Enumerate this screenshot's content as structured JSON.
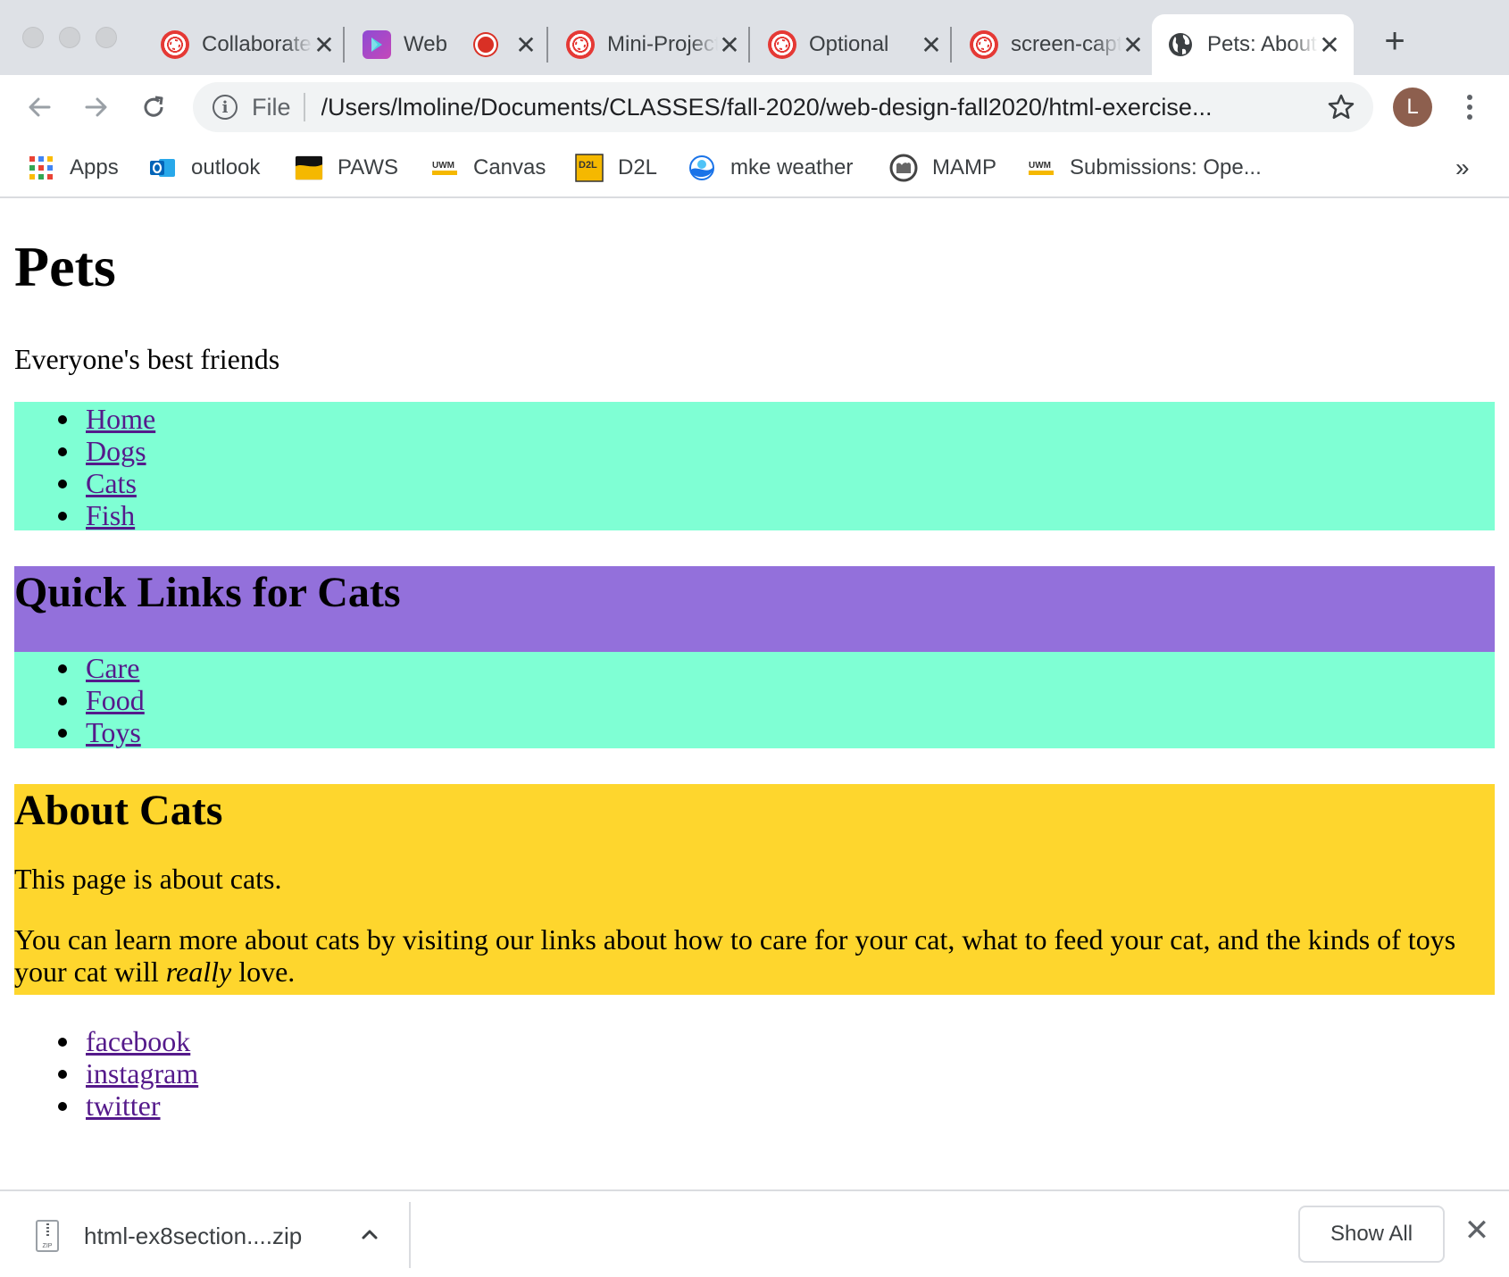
{
  "browser": {
    "tabs": [
      {
        "title": "Collaborate",
        "icon": "canvas-icon"
      },
      {
        "title": "Web",
        "icon": "web-app-icon",
        "recording": true
      },
      {
        "title": "Mini-Project",
        "icon": "canvas-icon"
      },
      {
        "title": "Optional",
        "icon": "canvas-icon"
      },
      {
        "title": "screen-capture",
        "icon": "canvas-icon"
      },
      {
        "title": "Pets: About Cats",
        "icon": "globe-icon",
        "active": true
      }
    ],
    "omnibox": {
      "scheme_label": "File",
      "url": "/Users/lmoline/Documents/CLASSES/fall-2020/web-design-fall2020/html-exercise..."
    },
    "avatar_initial": "L",
    "bookmarks": [
      {
        "label": "Apps"
      },
      {
        "label": "outlook"
      },
      {
        "label": "PAWS"
      },
      {
        "label": "Canvas"
      },
      {
        "label": "D2L"
      },
      {
        "label": "mke weather"
      },
      {
        "label": "MAMP"
      },
      {
        "label": "Submissions: Ope..."
      }
    ],
    "bookmarks_overflow": "»"
  },
  "page": {
    "title": "Pets",
    "tagline": "Everyone's best friends",
    "nav": [
      "Home",
      "Dogs",
      "Cats",
      "Fish"
    ],
    "quick_links_heading": "Quick Links for Cats",
    "quick_links": [
      "Care",
      "Food",
      "Toys"
    ],
    "about_heading": "About Cats",
    "about_p1": "This page is about cats.",
    "about_p2_before": "You can learn more about cats by visiting our links about how to care for your cat, what to feed your cat, and the kinds of toys your cat will ",
    "about_p2_em": "really",
    "about_p2_after": " love.",
    "social": [
      "facebook",
      "instagram",
      "twitter"
    ],
    "colors": {
      "nav_bg": "#7fffd4",
      "heading_bg": "#9370db",
      "about_bg": "#fed62d",
      "link": "#551a8b"
    }
  },
  "downloads": {
    "file_name": "html-ex8section....zip",
    "show_all_label": "Show All"
  }
}
